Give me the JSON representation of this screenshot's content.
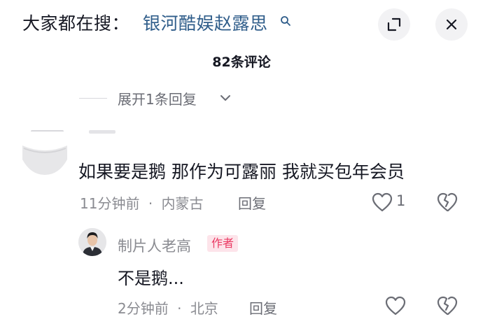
{
  "header": {
    "trending_prefix": "大家都在搜：",
    "trending_term": "银河酷娱赵露思",
    "expand_icon": "expand-icon",
    "close_icon": "close-icon"
  },
  "comments_title": "82条评论",
  "expand_replies": {
    "label": "展开1条回复",
    "icon": "chevron-down-icon"
  },
  "comment": {
    "text": "如果要是鹅 那作为可露丽 我就买包年会员",
    "time": "11分钟前",
    "separator": "·",
    "location": "内蒙古",
    "reply_label": "回复",
    "like_count": "1"
  },
  "reply": {
    "author_name": "制片人老高",
    "author_badge": "作者",
    "text": "不是鹅...",
    "time": "2分钟前",
    "separator": "·",
    "location": "北京",
    "reply_label": "回复"
  },
  "colors": {
    "link_blue": "#2f5d8a",
    "badge_pink": "#ea3a63",
    "badge_bg": "#fde4ea",
    "secondary_text": "#8a8b91"
  }
}
